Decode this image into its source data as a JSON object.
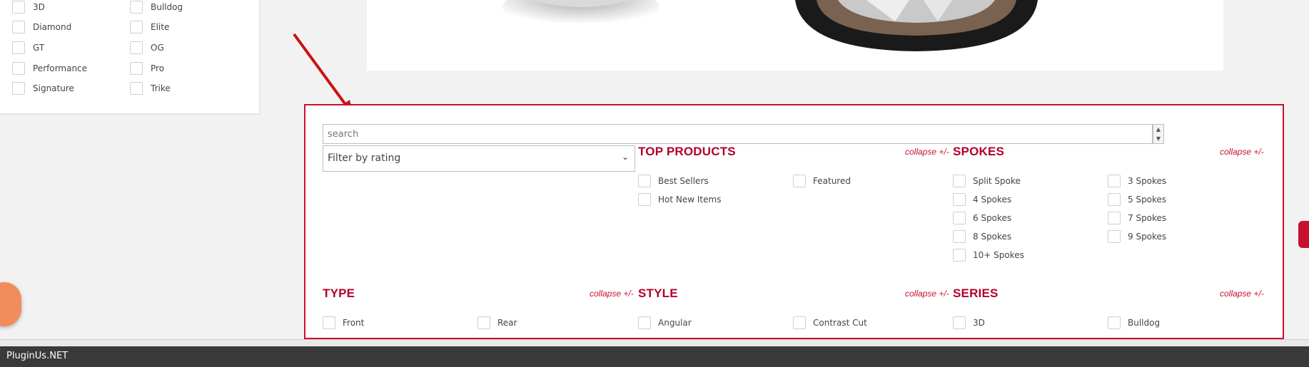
{
  "sidebar_filters": {
    "col1": [
      "3D",
      "Diamond",
      "GT",
      "Performance",
      "Signature"
    ],
    "col2": [
      "Bulldog",
      "Elite",
      "OG",
      "Pro",
      "Trike"
    ]
  },
  "filter_panel": {
    "search_placeholder": "search",
    "rating_select": "Filter by rating",
    "stepper_up": "▲",
    "stepper_down": "▼",
    "select_chevron": "⌄",
    "sections": {
      "top_products": {
        "title": "TOP PRODUCTS",
        "collapse": "collapse +/-",
        "items": [
          "Best Sellers",
          "Featured",
          "Hot New Items"
        ]
      },
      "spokes": {
        "title": "SPOKES",
        "collapse": "collapse +/-",
        "items": [
          "Split Spoke",
          "3 Spokes",
          "4 Spokes",
          "5 Spokes",
          "6 Spokes",
          "7 Spokes",
          "8 Spokes",
          "9 Spokes",
          "10+ Spokes"
        ]
      },
      "type": {
        "title": "TYPE",
        "collapse": "collapse +/-",
        "items": [
          "Front",
          "Rear"
        ]
      },
      "style": {
        "title": "STYLE",
        "collapse": "collapse +/-",
        "items": [
          "Angular",
          "Contrast Cut"
        ]
      },
      "series": {
        "title": "SERIES",
        "collapse": "collapse +/-",
        "items": [
          "3D",
          "Bulldog"
        ]
      }
    }
  },
  "bottom_bar": {
    "label": "PluginUs.NET"
  },
  "colors": {
    "accent_red": "#c8102e",
    "title_red": "#b0002a",
    "bar_dark": "#3a3a3a"
  },
  "icons": {
    "annotation_arrow": "red-arrow-icon",
    "chat": "chat-bubble-icon"
  }
}
